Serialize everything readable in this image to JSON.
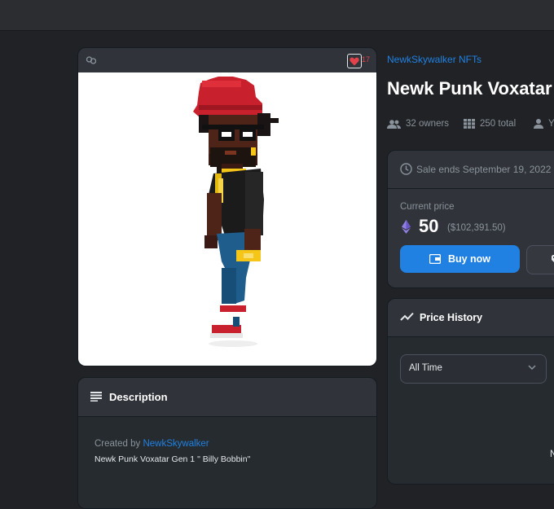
{
  "asset": {
    "favorites_count": "17"
  },
  "description": {
    "title": "Description",
    "created_by_prefix": "Created by",
    "creator": "NewkSkywalker",
    "text": "Newk Punk Voxatar Gen 1 \" Billy Bobbin\""
  },
  "item": {
    "collection": "NewkSkywalker NFTs",
    "title": "Newk Punk Voxatar"
  },
  "stats": {
    "owners": "32 owners",
    "total": "250 total",
    "favorites_partial": "Y"
  },
  "sale": {
    "ends": "Sale ends September 19, 2022",
    "price_label": "Current price",
    "price": "50",
    "price_usd": "($102,391.50)",
    "buy_label": "Buy now"
  },
  "price_history": {
    "title": "Price History",
    "time_filter": "All Time",
    "note_partial": "N"
  },
  "colors": {
    "accent": "#2081e2",
    "page_bg": "#202225",
    "panel_bg": "#303339",
    "heart": "#e2434b"
  },
  "icons": [
    "link-icon",
    "heart-icon",
    "lines-icon",
    "people-icon",
    "grid-icon",
    "person-icon",
    "clock-icon",
    "eth-icon",
    "wallet-icon",
    "tag-icon",
    "trend-icon",
    "chevron-down-icon"
  ]
}
